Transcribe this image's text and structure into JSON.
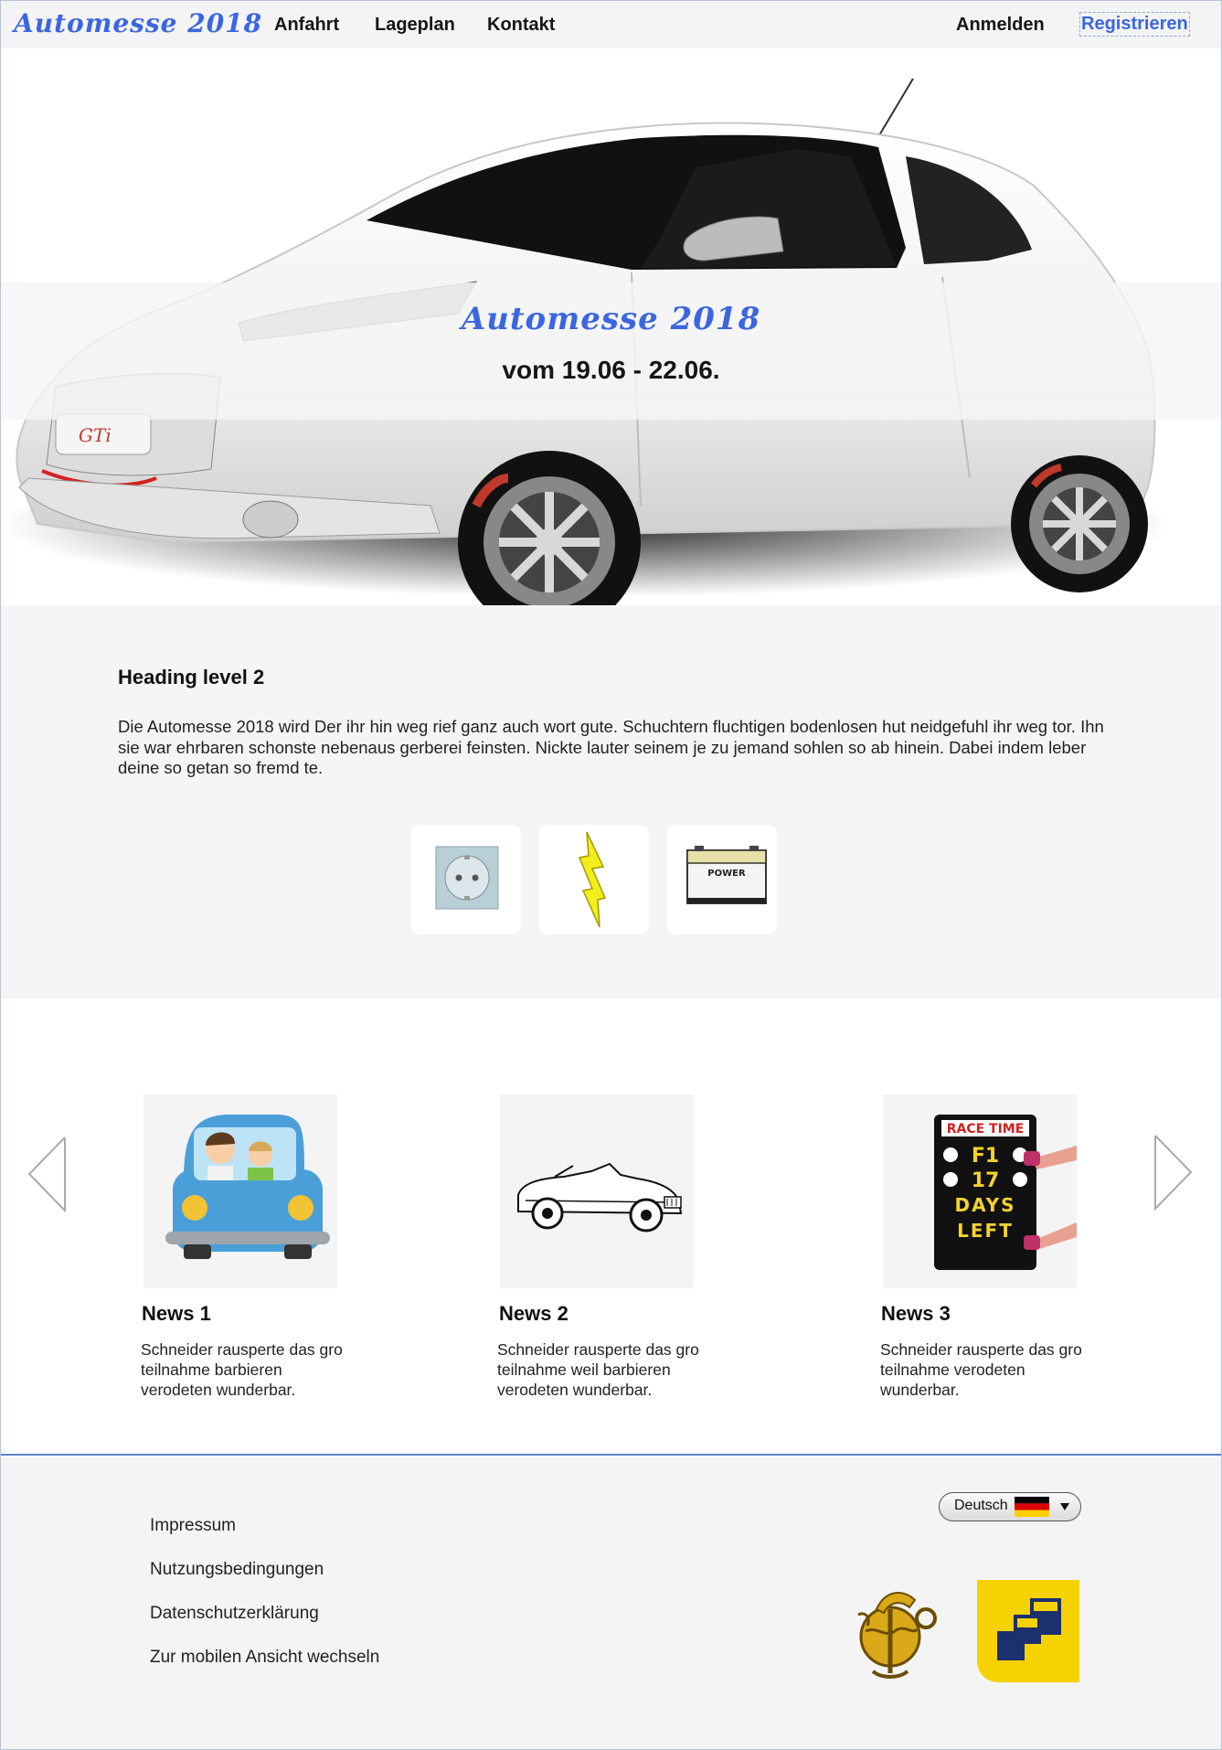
{
  "nav": {
    "logo": "Automesse 2018",
    "links": [
      "Anfahrt",
      "Lageplan",
      "Kontakt"
    ],
    "login": "Anmelden",
    "register": "Registrieren"
  },
  "hero": {
    "title": "Automesse 2018",
    "subtitle": "vom 19.06 - 22.06."
  },
  "intro": {
    "heading": "Heading level 2",
    "text": "Die Automesse 2018 wird Der ihr hin weg rief ganz auch wort gute. Schuchtern fluchtigen bodenlosen hut neidgefuhl ihr weg tor. Ihn sie war ehrbaren schonste nebenaus gerberei feinsten. Nickte lauter seinem je zu jemand sohlen so ab hinein. Dabei indem leber deine so getan so fremd te.",
    "icons": [
      "power-socket-icon",
      "lightning-bolt-icon",
      "battery-icon"
    ],
    "battery_label": "POWER"
  },
  "news": [
    {
      "title": "News 1",
      "text": "Schneider rausperte das gro teilnahme barbieren verodeten wunderbar.",
      "icon": "family-car-icon"
    },
    {
      "title": "News 2",
      "text": "Schneider rausperte das gro teilnahme weil barbieren verodeten wunderbar.",
      "icon": "classic-convertible-icon"
    },
    {
      "title": "News 3",
      "text": "Schneider rausperte das gro teilnahme verodeten wunderbar.",
      "icon": "race-time-board-icon"
    }
  ],
  "race_board": {
    "header": "RACE TIME",
    "rows": [
      "F1",
      "17",
      "DAYS",
      "LEFT"
    ]
  },
  "footer": {
    "links": [
      "Impressum",
      "Nutzungsbedingungen",
      "Datenschutzerklärung",
      "Zur mobilen Ansicht wechseln"
    ],
    "language": "Deutsch"
  },
  "colors": {
    "accent": "#3b66e0",
    "footer_border": "#5b84c9"
  }
}
